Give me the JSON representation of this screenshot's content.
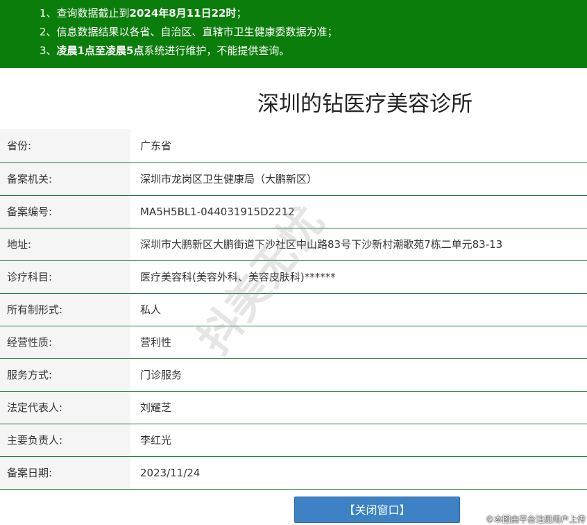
{
  "notice": {
    "line1_prefix": "1、查询数据截止到",
    "line1_bold": "2024年8月11日22时",
    "line1_suffix": "；",
    "line2": "2、信息数据结果以各省、自治区、直辖市卫生健康委数据为准；",
    "line3_prefix": "3、",
    "line3_bold": "凌晨1点至凌晨5点",
    "line3_suffix": "系统进行维护，不能提供查询。"
  },
  "clinic_name": "深圳的钻医疗美容诊所",
  "rows": [
    {
      "label": "省份:",
      "value": "广东省"
    },
    {
      "label": "备案机关:",
      "value": "深圳市龙岗区卫生健康局（大鹏新区）"
    },
    {
      "label": "备案编号:",
      "value": "MA5H5BL1-044031915D2212"
    },
    {
      "label": "地址:",
      "value": "深圳市大鹏新区大鹏街道下沙社区中山路83号下沙新村潮歌苑7栋二单元83-13"
    },
    {
      "label": "诊疗科目:",
      "value": "医疗美容科(美容外科、美容皮肤科)******"
    },
    {
      "label": "所有制形式:",
      "value": "私人"
    },
    {
      "label": "经营性质:",
      "value": "营利性"
    },
    {
      "label": "服务方式:",
      "value": "门诊服务"
    },
    {
      "label": "法定代表人:",
      "value": "刘耀芝"
    },
    {
      "label": "主要负责人:",
      "value": "李红光"
    },
    {
      "label": "备案日期:",
      "value": "2023/11/24"
    }
  ],
  "close_button": "【关闭窗口】",
  "watermark": "抖美无忧",
  "footer_note": "©本图由平台注册用户上传"
}
